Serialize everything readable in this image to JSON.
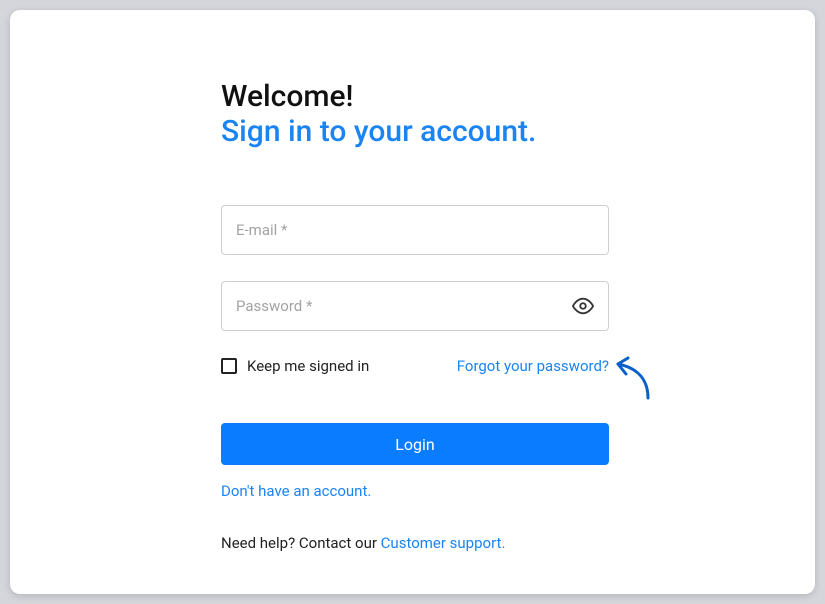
{
  "header": {
    "welcome": "Welcome!",
    "subtitle": "Sign in to your account."
  },
  "fields": {
    "email_placeholder": "E-mail *",
    "password_placeholder": "Password *"
  },
  "options": {
    "keep_signed_in": "Keep me signed in",
    "forgot_password": "Forgot your password?"
  },
  "actions": {
    "login": "Login",
    "no_account": "Don't have an account."
  },
  "help": {
    "prefix": "Need help? Contact our ",
    "link": "Customer support."
  },
  "colors": {
    "accent": "#0a7cff",
    "link": "#1a84f2"
  }
}
